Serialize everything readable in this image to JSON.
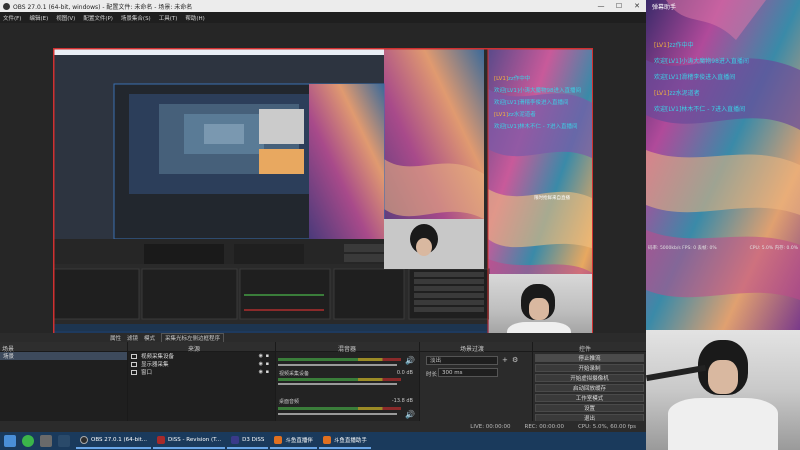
{
  "window": {
    "title": "OBS 27.0.1 (64-bit, windows) - 配置文件: 未命名 - 场景: 未命名",
    "min": "—",
    "max": "☐",
    "close": "✕"
  },
  "menu": [
    "文件(F)",
    "编辑(E)",
    "视图(V)",
    "配置文件(P)",
    "场景集合(S)",
    "工具(T)",
    "帮助(H)"
  ],
  "preview": {
    "chat_lines": [
      {
        "lv": "[LV1]",
        "text": "zz作中中"
      },
      {
        "lv": "",
        "text": "欢迎[LV1]小涛大魔物98进入直播间"
      },
      {
        "lv": "",
        "text": "欢迎[LV1]滑稽李俊进入直播间"
      },
      {
        "lv": "[LV1]",
        "text": "zz水泥道者"
      },
      {
        "lv": "",
        "text": "欢迎[LV1]林木不仁 - 7进入直播间"
      }
    ],
    "overlay_watermark": "限时抢鲜来自直播"
  },
  "docks": {
    "scenes": {
      "title": "场景",
      "items": [
        "场景"
      ]
    },
    "sources": {
      "title": "来源",
      "items": [
        "视频采集设备",
        "显示器采集",
        "窗口"
      ]
    },
    "mixer": {
      "title": "混音器",
      "channels": [
        {
          "name": "视频采集设备",
          "db": "0.0 dB"
        },
        {
          "name": "桌面音频",
          "db": "-13.8 dB"
        }
      ]
    },
    "transitions": {
      "title": "场景过渡",
      "type": "淡出",
      "duration_label": "时长",
      "duration": "300 ms"
    },
    "controls": {
      "title": "控件",
      "buttons": [
        "停止推流",
        "开始录制",
        "开始虚拟摄像机",
        "启动回放缓存",
        "工作室模式",
        "设置",
        "退出"
      ]
    },
    "toolbar": {
      "properties": "属性",
      "filters": "滤镜",
      "mode": "模式",
      "mode_value": "采集光标左侧边框程序"
    }
  },
  "status": {
    "live": "LIVE: 00:00:00",
    "rec": "REC: 00:00:00",
    "cpu": "CPU: 5.0%, 60.00 fps"
  },
  "taskbar": {
    "apps": [
      {
        "label": "OBS 27.0.1 (64-bit...",
        "color": "#2d2d2d"
      },
      {
        "label": "DiSS - Revision (T...",
        "color": "#a82a2a"
      },
      {
        "label": "D3 DiSS",
        "color": "#3a3a8a"
      },
      {
        "label": "斗鱼直播伴",
        "color": "#e07020"
      },
      {
        "label": "斗鱼直播助手",
        "color": "#e07020"
      }
    ]
  },
  "side": {
    "header": "弹幕助手",
    "chat_lines": [
      {
        "lv": "[LV1]",
        "text": "zz作中中"
      },
      {
        "lv": "",
        "text": "欢迎[LV1]小涛大魔物98进入直播间"
      },
      {
        "lv": "",
        "text": "欢迎[LV1]滑稽李俊进入直播间"
      },
      {
        "lv": "[LV1]",
        "text": "zz水泥道者"
      },
      {
        "lv": "",
        "text": "欢迎[LV1]林木不仁 - 7进入直播间"
      }
    ],
    "stats_left": "码率: 5000kb/s  FPS: 0  丢帧: 0%",
    "stats_right": "CPU: 5.0%  内存: 0.0%"
  },
  "colors": {
    "accent_red": "#d03030",
    "chat_cyan": "#3bd1e6",
    "level_gold": "#f2b23e",
    "taskbar_blue": "#1a3a5c"
  }
}
